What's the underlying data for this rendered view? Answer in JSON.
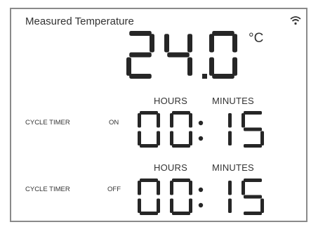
{
  "panel": {
    "title": "Measured Temperature",
    "wifi_icon": "wifi-icon"
  },
  "temperature": {
    "value": "24.0",
    "unit": "°C"
  },
  "timer_on": {
    "hours_label": "HOURS",
    "minutes_label": "MINUTES",
    "cycle_label": "CYCLE TIMER",
    "state_label": "ON",
    "hours": "00",
    "minutes": "15"
  },
  "timer_off": {
    "hours_label": "HOURS",
    "minutes_label": "MINUTES",
    "cycle_label": "CYCLE TIMER",
    "state_label": "OFF",
    "hours": "00",
    "minutes": "15"
  },
  "colors": {
    "segment": "#262626",
    "border": "#8a8a8a",
    "background": "#ffffff"
  }
}
